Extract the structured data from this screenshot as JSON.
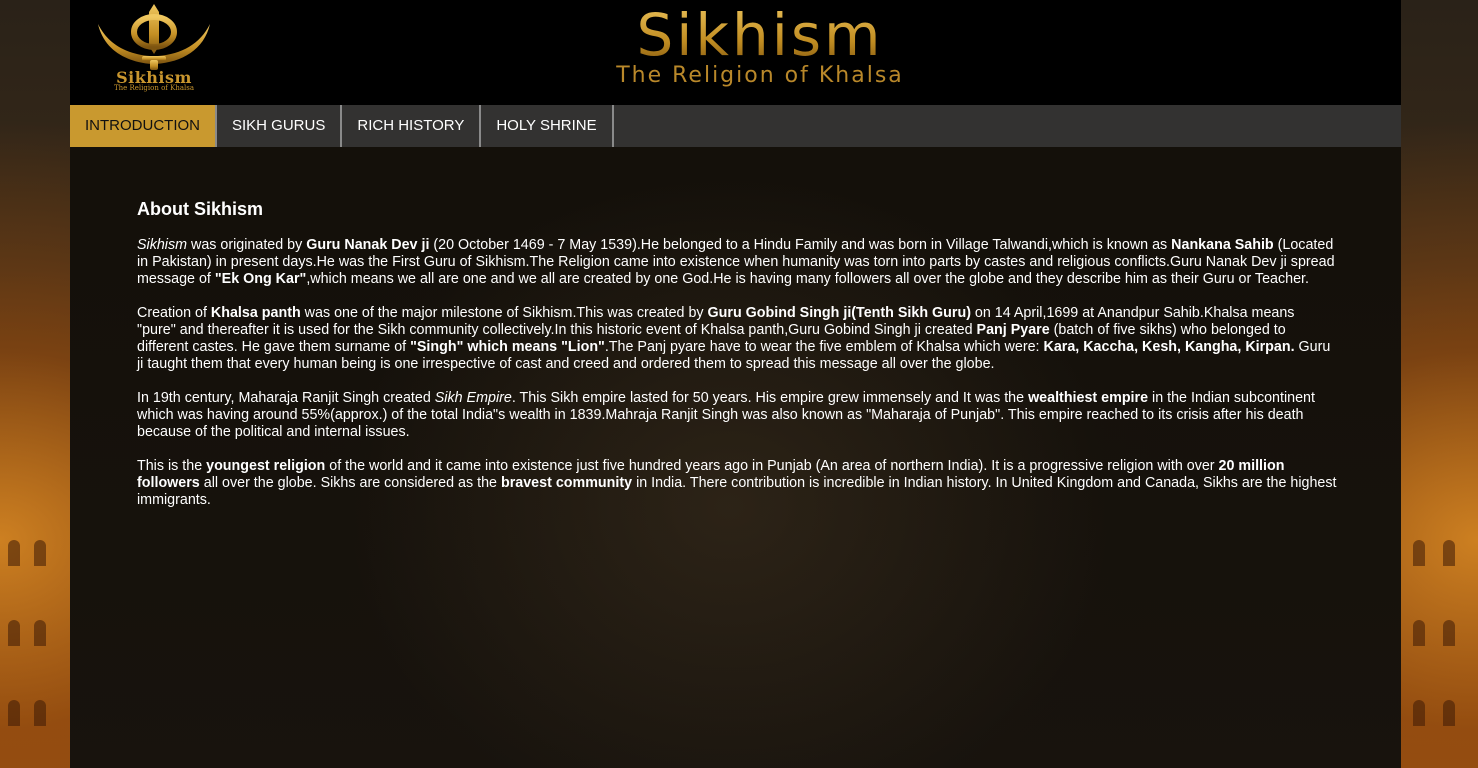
{
  "header": {
    "logo_name": "Sikhism",
    "logo_tagline": "The Religion of Khalsa",
    "banner_title": "Sikhism",
    "banner_subtitle": "The Religion of Khalsa"
  },
  "nav": {
    "items": [
      {
        "label": "INTRODUCTION",
        "active": true
      },
      {
        "label": "SIKH GURUS",
        "active": false
      },
      {
        "label": "RICH HISTORY",
        "active": false
      },
      {
        "label": "HOLY SHRINE",
        "active": false
      }
    ]
  },
  "article": {
    "heading": "About Sikhism",
    "p1": {
      "s1": "Sikhism",
      "s2": " was originated by ",
      "s3": "Guru Nanak Dev ji",
      "s4": " (20 October 1469 - 7 May 1539).He belonged to a Hindu Family and was born in Village Talwandi,which is known as ",
      "s5": "Nankana Sahib",
      "s6": " (Located in Pakistan) in present days.He was the First Guru of Sikhism.The Religion came into existence when humanity was torn into parts by castes and religious conflicts.Guru Nanak Dev ji spread message of ",
      "s7": "\"Ek Ong Kar\"",
      "s8": ",which means we all are one and we all are created by one God.He is having many followers all over the globe and they describe him as their Guru or Teacher."
    },
    "p2": {
      "s1": "Creation of ",
      "s2": "Khalsa panth",
      "s3": " was one of the major milestone of Sikhism.This was created by ",
      "s4": "Guru Gobind Singh ji(Tenth Sikh Guru)",
      "s5": " on 14 April,1699 at Anandpur Sahib.Khalsa means \"pure\" and thereafter it is used for the Sikh community collectively.In this historic event of Khalsa panth,Guru Gobind Singh ji created ",
      "s6": "Panj Pyare",
      "s7": " (batch of five sikhs) who belonged to different castes. He gave them surname of ",
      "s8": "\"Singh\" which means \"Lion\"",
      "s9": ".The Panj pyare have to wear the five emblem of Khalsa which were: ",
      "s10": "Kara, Kaccha, Kesh, Kangha, Kirpan.",
      "s11": " Guru ji taught them that every human being is one irrespective of cast and creed and ordered them to spread this message all over the globe."
    },
    "p3": {
      "s1": "In 19th century, Maharaja Ranjit Singh created ",
      "s2": "Sikh Empire",
      "s3": ". This Sikh empire lasted for 50 years. His empire grew immensely and It was the ",
      "s4": "wealthiest empire",
      "s5": " in the Indian subcontinent which was having around 55%(approx.) of the total India\"s wealth in 1839.Mahraja Ranjit Singh was also known as \"Maharaja of Punjab\". This empire reached to its crisis after his death because of the political and internal issues."
    },
    "p4": {
      "s1": "This is the ",
      "s2": "youngest religion",
      "s3": " of the world and it came into existence just five hundred years ago in Punjab (An area of northern India). It is a progressive religion with over ",
      "s4": "20 million followers",
      "s5": " all over the globe. Sikhs are considered as the ",
      "s6": "bravest community",
      "s7": " in India. There contribution is incredible in Indian history. In United Kingdom and Canada, Sikhs are the highest immigrants."
    }
  },
  "colors": {
    "accent_gold": "#c9992f",
    "nav_background": "#333231",
    "header_background": "#000000"
  }
}
